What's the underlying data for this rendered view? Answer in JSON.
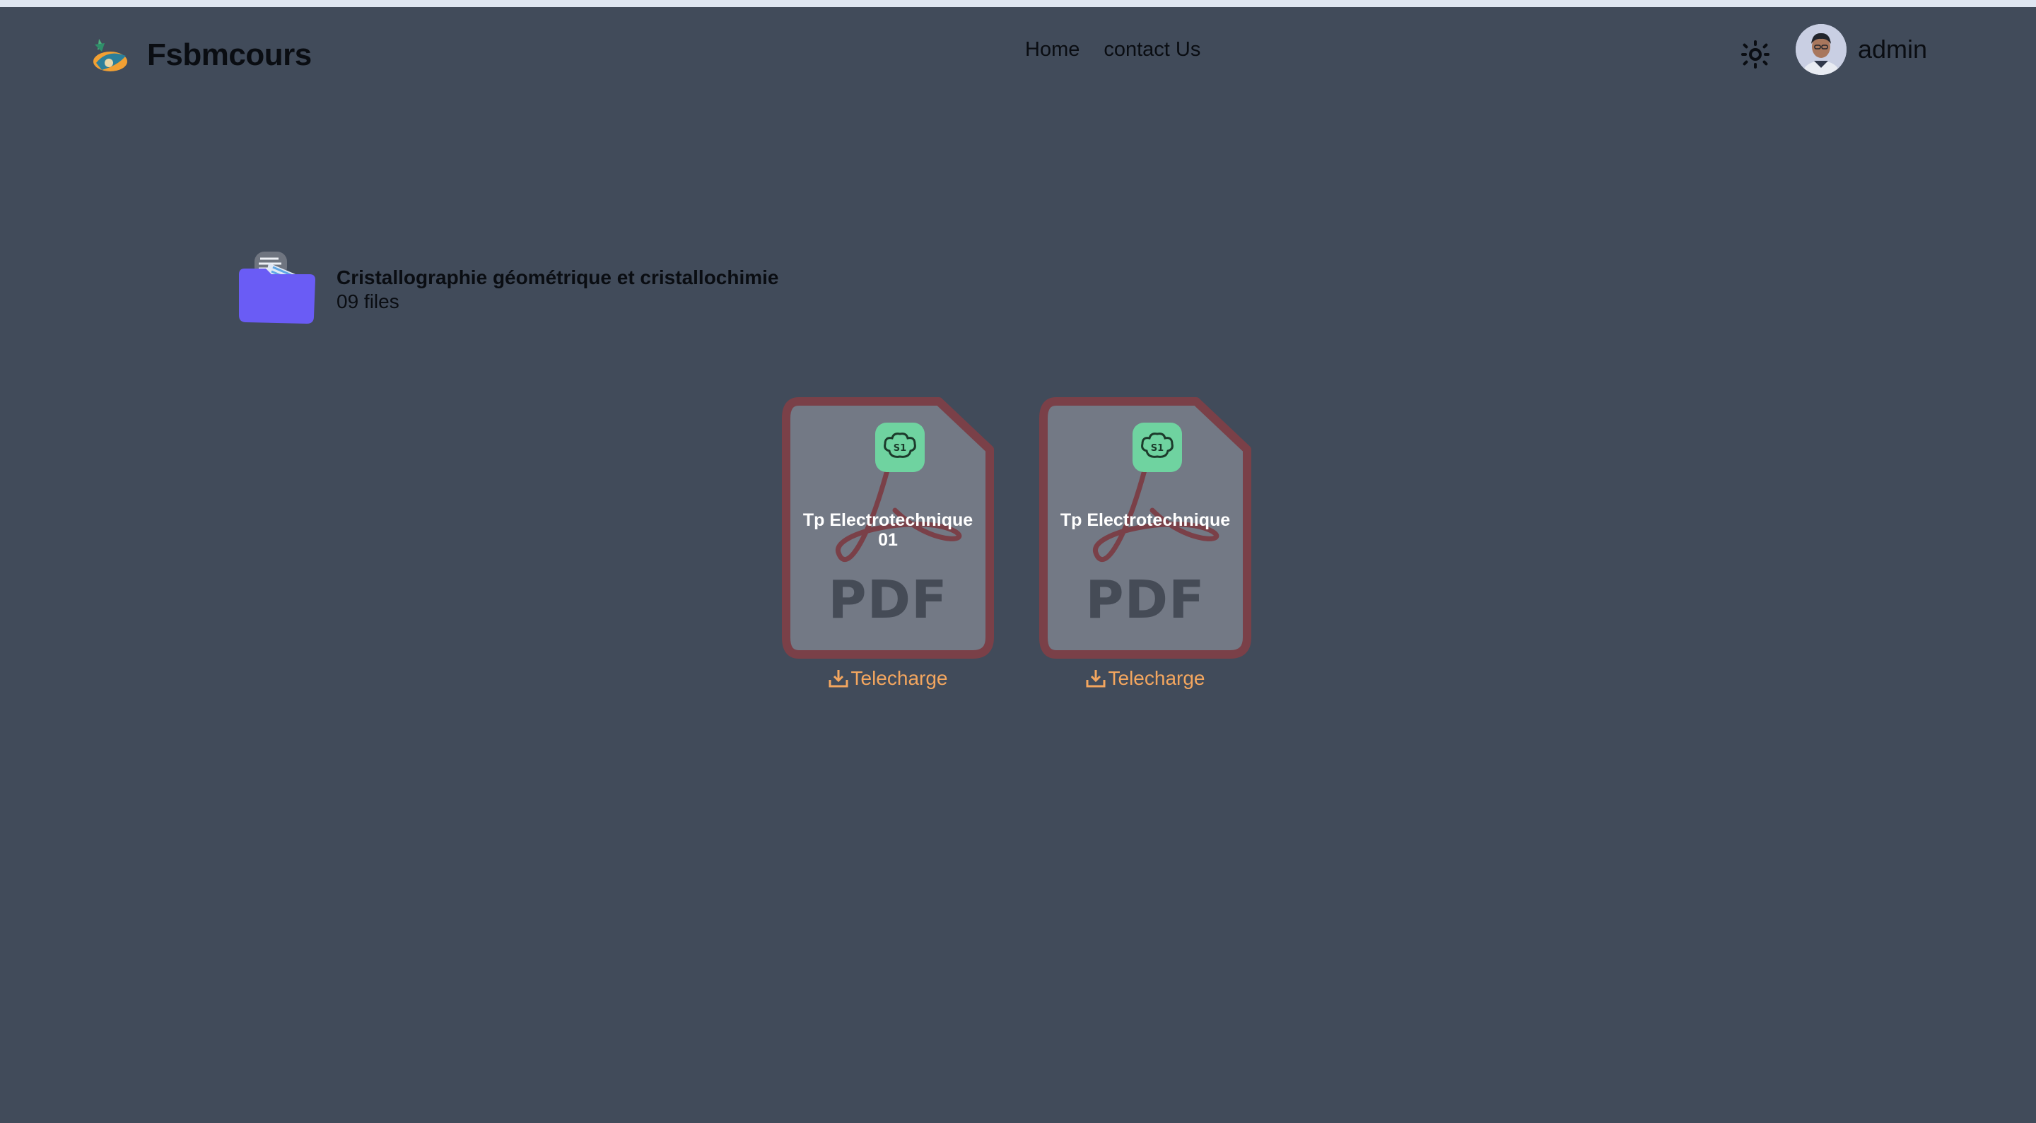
{
  "navbar": {
    "brand_name": "Fsbmcours",
    "links": [
      {
        "label": "Home"
      },
      {
        "label": "contact Us"
      }
    ],
    "theme_icon": "sun-icon",
    "user_name": "admin"
  },
  "folder": {
    "title": "Cristallographie géométrique et cristallochimie",
    "count": "09 files",
    "icon": "folder-icon"
  },
  "files": [
    {
      "name": "Tp Electrotechnique 01",
      "type_label": "PDF",
      "download_label": "Telecharge"
    },
    {
      "name": "Tp Electrotechnique",
      "type_label": "PDF",
      "download_label": "Telecharge"
    }
  ],
  "colors": {
    "background": "#414b5a",
    "card_fill": "#737985",
    "card_border": "#7a4048",
    "download_accent": "#f3a65f",
    "folder_accent": "#6a5cf5",
    "badge_green": "#6fd3a0"
  }
}
